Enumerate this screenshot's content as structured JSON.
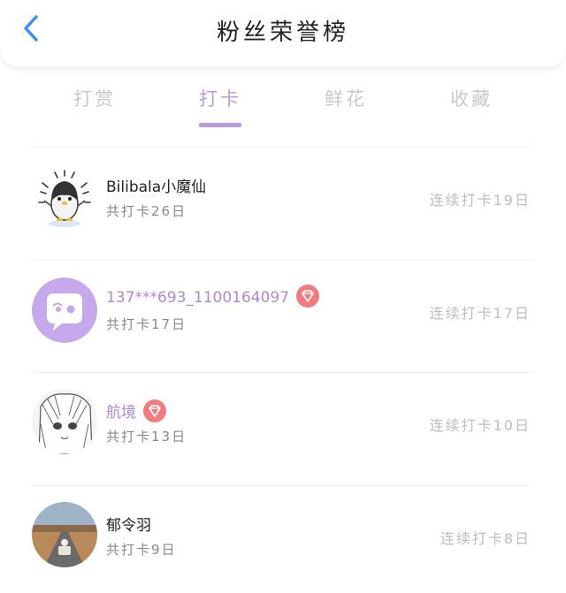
{
  "header": {
    "title": "粉丝荣誉榜",
    "back_icon": "chevron-left-icon"
  },
  "tabs": [
    {
      "label": "打赏",
      "active": false
    },
    {
      "label": "打卡",
      "active": true
    },
    {
      "label": "鲜花",
      "active": false
    },
    {
      "label": "收藏",
      "active": false
    }
  ],
  "colors": {
    "accent": "#b79ce2",
    "vip_name": "#a98ad8",
    "back_icon": "#3a8ff0",
    "gem_badge": "#f07c80"
  },
  "fans": [
    {
      "name": "Bilibala小魔仙",
      "total": "共打卡26日",
      "streak": "连续打卡19日",
      "vip": false,
      "avatar": "penguin-avatar"
    },
    {
      "name": "137***693_1100164097",
      "total": "共打卡17日",
      "streak": "连续打卡17日",
      "vip": true,
      "avatar": "chat-bubble-avatar"
    },
    {
      "name": "航境",
      "total": "共打卡13日",
      "streak": "连续打卡10日",
      "vip": true,
      "avatar": "anime-sketch-avatar"
    },
    {
      "name": "郁令羽",
      "total": "共打卡9日",
      "streak": "连续打卡8日",
      "vip": false,
      "avatar": "road-photo-avatar"
    }
  ]
}
